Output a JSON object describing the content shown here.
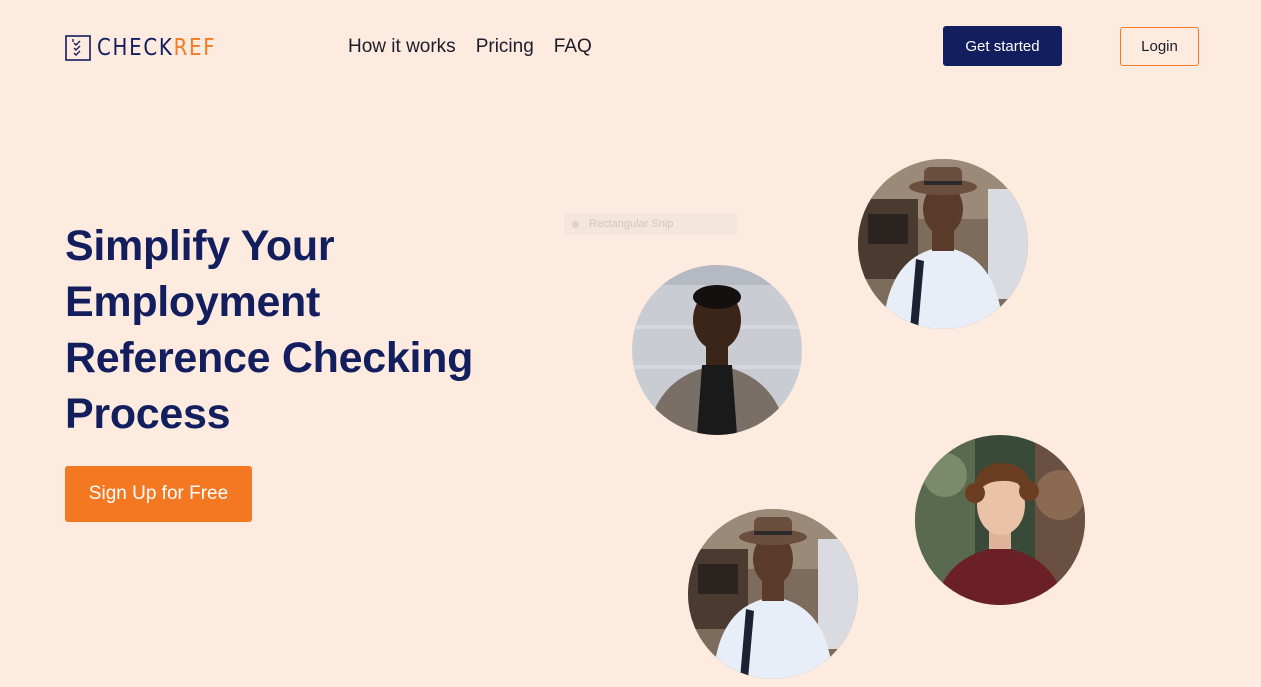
{
  "header": {
    "logo": {
      "part1": "CHECK",
      "part2": "REF",
      "icon": "checklist-icon"
    },
    "nav": [
      {
        "label": "How it works"
      },
      {
        "label": "Pricing"
      },
      {
        "label": "FAQ"
      }
    ],
    "get_started_label": "Get started",
    "login_label": "Login"
  },
  "hero": {
    "title": "Simplify Your Employment Reference Checking Process",
    "cta_label": "Sign Up for Free"
  },
  "overlay": {
    "snip_label": "Rectangular Snip"
  },
  "photos": [
    {
      "name": "man-with-hat-photo"
    },
    {
      "name": "man-in-blazer-photo"
    },
    {
      "name": "curly-haired-man-photo"
    },
    {
      "name": "man-with-hat-photo"
    }
  ],
  "colors": {
    "background": "#fdebe0",
    "navy": "#121e5e",
    "orange": "#f47721"
  }
}
